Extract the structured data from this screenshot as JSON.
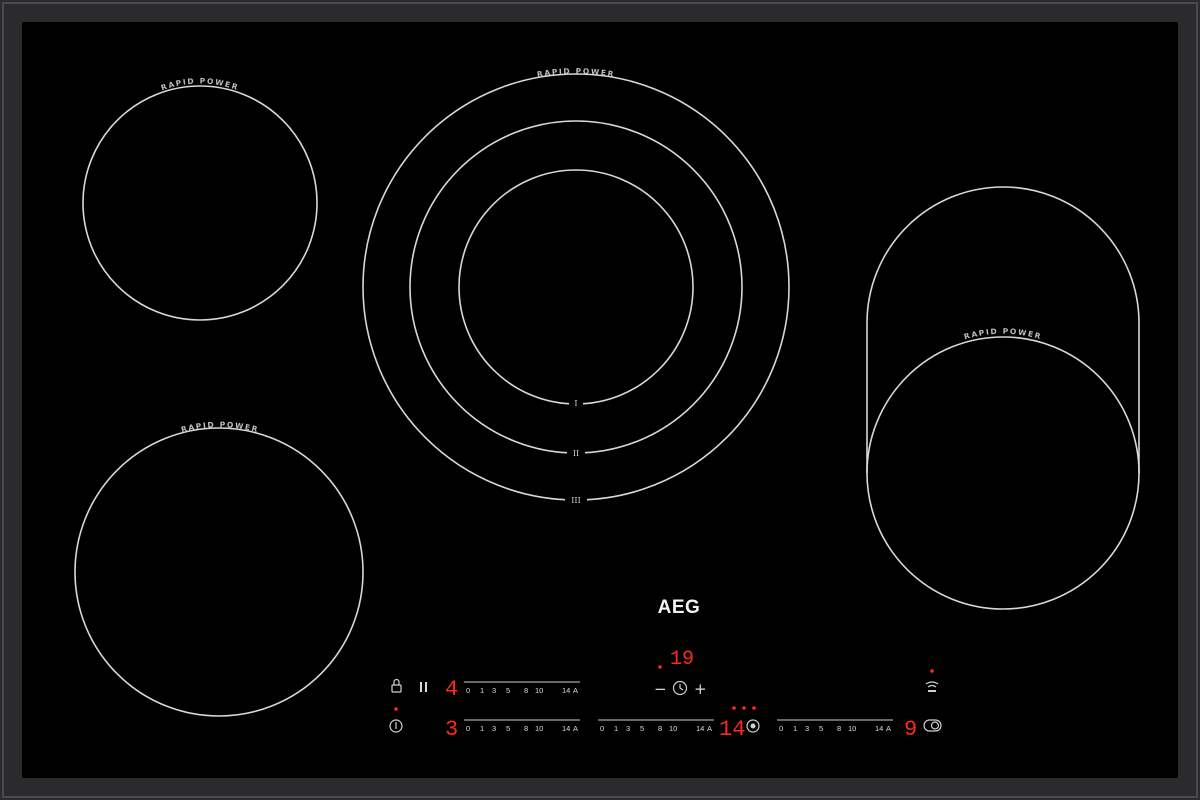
{
  "brand": "AEG",
  "zones": {
    "front_left_label": "RAPID POWER",
    "rear_left_label": "RAPID POWER",
    "center_label": "RAPID POWER",
    "right_label": "RAPID POWER",
    "center_ring_1": "I",
    "center_ring_2": "II",
    "center_ring_3": "III"
  },
  "display": {
    "timer_value": "19",
    "upper_left_level": "4",
    "lower_left_level": "3",
    "center_level": "14",
    "right_level": "9",
    "minus_symbol": "−",
    "plus_symbol": "+"
  },
  "slider_scale": {
    "s0": "0",
    "s1": "1",
    "s3": "3",
    "s5": "5",
    "s8": "8",
    "s10": "10",
    "s14": "14",
    "sA": "A"
  },
  "colors": {
    "glass": "#000000",
    "frame": "#2b2b2e",
    "ring": "#d8d8d8",
    "display_red": "#ff2a1a"
  }
}
